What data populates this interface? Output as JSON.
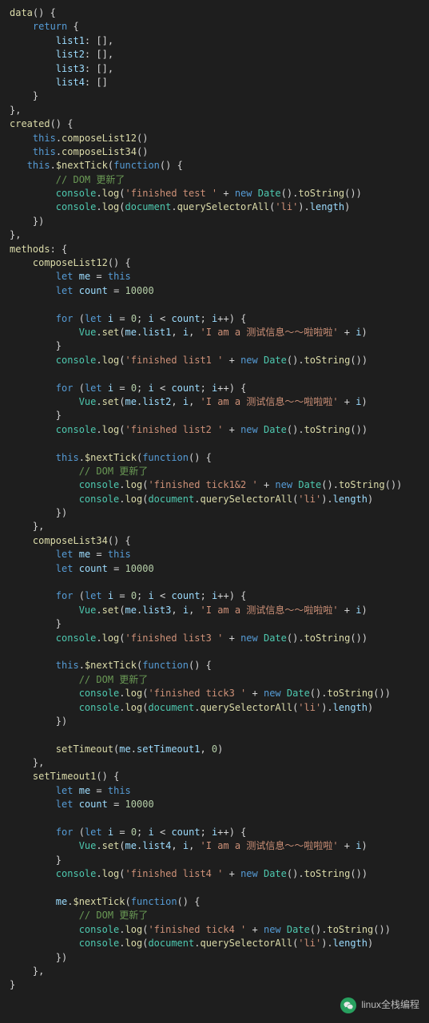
{
  "code": {
    "dataProps": [
      "list1",
      "list2",
      "list3",
      "list4"
    ],
    "count": "10000",
    "domComment": "// DOM 更新了",
    "messages": {
      "finished_test": "'finished test '",
      "finished_list1": "'finished list1 '",
      "finished_list2": "'finished list2 '",
      "finished_list3": "'finished list3 '",
      "finished_list4": "'finished list4 '",
      "finished_tick12": "'finished tick1&2 '",
      "finished_tick3": "'finished tick3 '",
      "finished_tick4": "'finished tick4 '",
      "iam": "'I am a 测试信息～～啦啦啦'",
      "li": "'li'"
    },
    "methods": [
      "composeList12",
      "composeList34",
      "setTimeout1"
    ],
    "lists_in_12": [
      "list1",
      "list2"
    ],
    "lists_in_34_loop": [
      "list3"
    ],
    "list_in_timeout": "list4",
    "setTimeoutDelay": "0"
  },
  "watermark": {
    "text": "linux全栈编程"
  }
}
